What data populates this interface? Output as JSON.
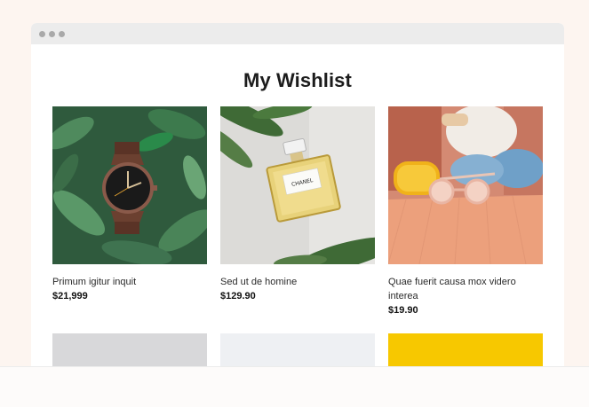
{
  "page": {
    "title": "My Wishlist"
  },
  "products": [
    {
      "name": "Primum igitur inquit",
      "price": "$21,999",
      "icon": "wristwatch-photo"
    },
    {
      "name": "Sed ut de homine",
      "price": "$129.90",
      "icon": "perfume-bottle-photo",
      "bottle_label": "CHANEL"
    },
    {
      "name": "Quae fuerit causa mox videro interea",
      "price": "$19.90",
      "icon": "sunglasses-photo"
    }
  ],
  "colors": {
    "accent_yellow": "#f7c800",
    "text_dark": "#1c1c1c",
    "window_bar": "#ececec"
  }
}
